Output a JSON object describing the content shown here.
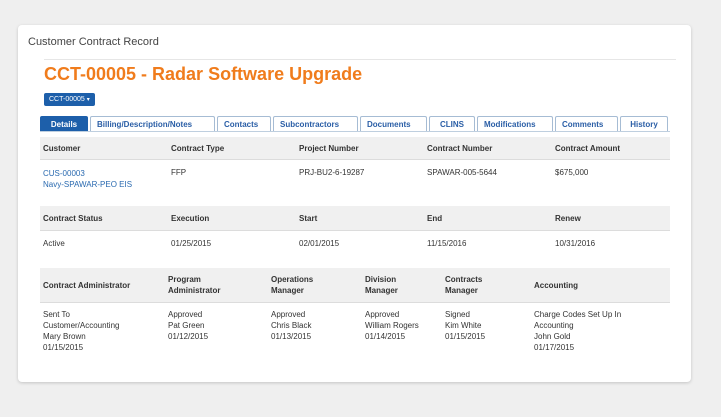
{
  "record_label": "Customer Contract Record",
  "title": "CCT-00005 - Radar Software Upgrade",
  "dropdown": {
    "label": "CCT-00005",
    "caret": "▾"
  },
  "tabs": [
    {
      "label": "Details",
      "active": true
    },
    {
      "label": "Billing/Description/Notes",
      "active": false
    },
    {
      "label": "Contacts",
      "active": false
    },
    {
      "label": "Subcontractors",
      "active": false
    },
    {
      "label": "Documents",
      "active": false
    },
    {
      "label": "CLINS",
      "active": false
    },
    {
      "label": "Modifications",
      "active": false
    },
    {
      "label": "Comments",
      "active": false
    },
    {
      "label": "History",
      "active": false
    }
  ],
  "section1": {
    "headers": [
      "Customer",
      "Contract Type",
      "Project Number",
      "Contract Number",
      "Contract Amount"
    ],
    "customer_id": "CUS-00003",
    "customer_name": "Navy-SPAWAR-PEO EIS",
    "contract_type": "FFP",
    "project_number": "PRJ-BU2-6-19287",
    "contract_number": "SPAWAR-005-5644",
    "contract_amount": "$675,000"
  },
  "section2": {
    "headers": [
      "Contract Status",
      "Execution",
      "Start",
      "End",
      "Renew"
    ],
    "values": [
      "Active",
      "01/25/2015",
      "02/01/2015",
      "11/15/2016",
      "10/31/2016"
    ]
  },
  "section3": {
    "headers": [
      [
        "Contract Administrator"
      ],
      [
        "Program",
        "Administrator"
      ],
      [
        "Operations",
        "Manager"
      ],
      [
        "Division",
        "Manager"
      ],
      [
        "Contracts",
        "Manager"
      ],
      [
        "Accounting"
      ]
    ],
    "values": [
      [
        "Sent To",
        "Customer/Accounting",
        "Mary Brown",
        "01/15/2015"
      ],
      [
        "Approved",
        "Pat Green",
        "01/12/2015"
      ],
      [
        "Approved",
        "Chris Black",
        "01/13/2015"
      ],
      [
        "Approved",
        "William Rogers",
        "01/14/2015"
      ],
      [
        "Signed",
        "Kim White",
        "01/15/2015"
      ],
      [
        "Charge Codes Set Up In",
        "Accounting",
        "John Gold",
        "01/17/2015"
      ]
    ]
  }
}
